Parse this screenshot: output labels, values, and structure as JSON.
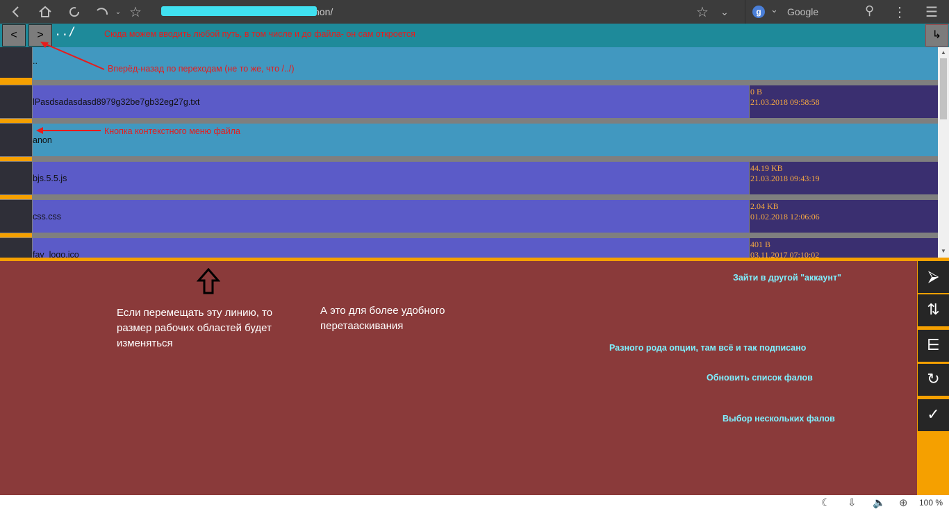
{
  "browser": {
    "url_suffix": "non/",
    "search_placeholder": "Google",
    "search_engine_letter": "g"
  },
  "path_bar": {
    "back_label": "<",
    "forward_label": ">",
    "path_value": "../",
    "hint": "Сюда можем вводить любой путь, в том числе и до файла- он сам откроется",
    "enter_label": "↳"
  },
  "annotations": {
    "nav_hint": "Вперёд-назад по переходам (не то же, что /../)",
    "context_hint": "Кнопка контекстного меню файла"
  },
  "files": [
    {
      "name": "..",
      "type": "folder"
    },
    {
      "name": "lPasdsadasdasd8979g32be7gb32eg27g.txt",
      "type": "file",
      "size": "0 B",
      "date": "21.03.2018 09:58:58"
    },
    {
      "name": "anon",
      "type": "folder"
    },
    {
      "name": "bjs.5.5.js",
      "type": "file",
      "size": "44.19 KB",
      "date": "21.03.2018 09:43:19"
    },
    {
      "name": "css.css",
      "type": "file",
      "size": "2.04 KB",
      "date": "01.02.2018 12:06:06"
    },
    {
      "name": "fav_logo.ico",
      "type": "file",
      "size": "401 B",
      "date": "03.11.2017 07:10:02"
    }
  ],
  "panel": {
    "resize_note": "Если перемещать эту линию, то размер рабочих областей будет изменяться",
    "drag_note": "А это для более удобного перетааскивания",
    "account_note": "Зайти в другой \"аккаунт\"",
    "options_note": "Разного рода опции, там всё и так подписано",
    "refresh_note": "Обновить список фалов",
    "select_note": "Выбор нескольких фалов"
  },
  "side_buttons": [
    {
      "icon": "login-icon",
      "glyph": "⮚"
    },
    {
      "icon": "sort-icon",
      "glyph": "⇅"
    },
    {
      "icon": "options-icon",
      "glyph": "⋿"
    },
    {
      "icon": "refresh-icon",
      "glyph": "↻"
    },
    {
      "icon": "check-icon",
      "glyph": "✓"
    }
  ],
  "status_bar": {
    "zoom": "100 %"
  },
  "colors": {
    "path_bar": "#1e8a9a",
    "folder_row": "#4198c0",
    "file_row": "#5b5bc8",
    "meta_bg": "#3a2f70",
    "accent": "#f5a000",
    "panel": "#8a3a3a",
    "annotation_red": "#e81b1b",
    "annotation_cyan": "#7ff0ff"
  }
}
